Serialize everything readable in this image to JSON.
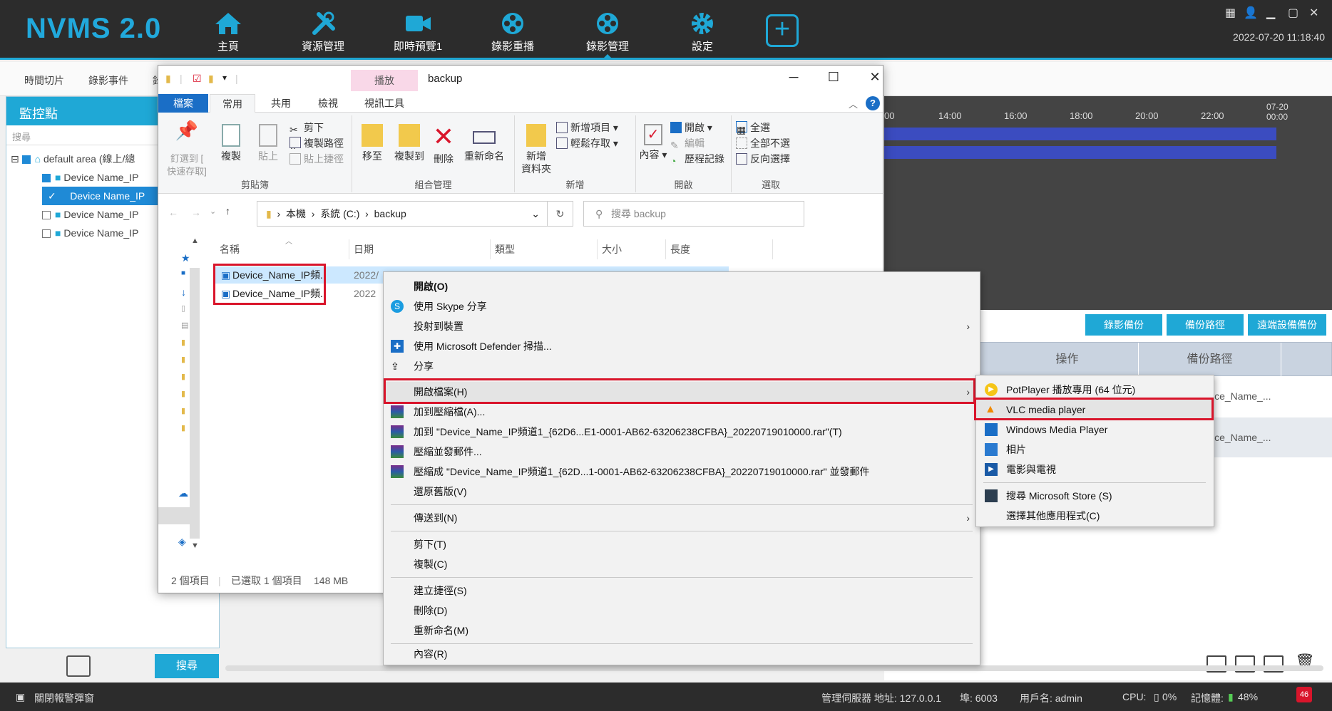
{
  "app": {
    "title": "NVMS 2.0",
    "datetime": "2022-07-20 11:18:40",
    "nav": [
      {
        "label": "主頁",
        "icon": "home-icon"
      },
      {
        "label": "資源管理",
        "icon": "tools-icon"
      },
      {
        "label": "即時預覽1",
        "icon": "camera-icon"
      },
      {
        "label": "錄影重播",
        "icon": "film-reel-icon"
      },
      {
        "label": "錄影管理",
        "icon": "film-reel-icon"
      },
      {
        "label": "設定",
        "icon": "gear-icon"
      }
    ],
    "subtabs": [
      "時間切片",
      "錄影事件",
      "錄"
    ],
    "left_panel": {
      "title": "監控點",
      "search_placeholder": "搜尋",
      "tree": [
        "default area (線上/總",
        "Device Name_IP",
        "Device Name_IP",
        "Device Name_IP",
        "Device Name_IP"
      ],
      "search_button": "搜尋"
    },
    "timeline_ticks": [
      "00",
      "14:00",
      "16:00",
      "18:00",
      "20:00",
      "22:00",
      "07-20",
      "00:00"
    ],
    "buttons": [
      "錄影備份",
      "備份路徑",
      "遠端設備備份"
    ],
    "grid_headers": [
      "操作",
      "備份路徑"
    ],
    "grid_values": [
      "ice_Name_...",
      "ice_Name_..."
    ],
    "status": {
      "alarm_popup": "關閉報警彈窗",
      "server": "管理伺服器 地址: 127.0.0.1",
      "port": "埠: 6003",
      "user": "用戶名: admin",
      "cpu": "CPU:",
      "cpu_val": "0%",
      "mem": "記憶體:",
      "mem_val": "48%",
      "badge": "46"
    }
  },
  "explorer": {
    "title": "backup",
    "tool_tab": "播放",
    "tool_tab_sub": "視訊工具",
    "ribbon_tabs": [
      "檔案",
      "常用",
      "共用",
      "檢視"
    ],
    "clipboard": {
      "pin": "釘選到 [\n快速存取]",
      "copy": "複製",
      "paste": "貼上",
      "cut": "剪下",
      "copy_path": "複製路徑",
      "paste_shortcut": "貼上捷徑",
      "label": "剪貼簿"
    },
    "organize": {
      "move": "移至",
      "copy_to": "複製到",
      "delete": "刪除",
      "rename": "重新命名",
      "label": "組合管理"
    },
    "new": {
      "new_folder": "新增\n資料夾",
      "new_item": "新增項目",
      "easy_access": "輕鬆存取",
      "label": "新增"
    },
    "open": {
      "properties": "內容",
      "open": "開啟",
      "edit": "編輯",
      "history": "歷程記錄",
      "label": "開啟"
    },
    "select": {
      "all": "全選",
      "none": "全部不選",
      "invert": "反向選擇",
      "label": "選取"
    },
    "address": {
      "parts": [
        "本機",
        "系統 (C:)",
        "backup"
      ],
      "search_placeholder": "搜尋 backup"
    },
    "columns": [
      "名稱",
      "日期",
      "類型",
      "大小",
      "長度"
    ],
    "files": [
      {
        "name": "Device_Name_IP頻...",
        "date": "2022/"
      },
      {
        "name": "Device_Name_IP頻...",
        "date": "2022"
      }
    ],
    "statusbar": {
      "count": "2 個項目",
      "selected": "已選取 1 個項目",
      "size": "148 MB"
    }
  },
  "context_menu": [
    {
      "label": "開啟(O)",
      "bold": true
    },
    {
      "label": "使用 Skype 分享",
      "icon": "skype-icon"
    },
    {
      "label": "投射到裝置",
      "submenu": true
    },
    {
      "label": "使用 Microsoft Defender 掃描...",
      "icon": "defender-shield-icon"
    },
    {
      "label": "分享",
      "icon": "share-icon"
    },
    {
      "label": "開啟檔案(H)",
      "submenu": true
    },
    {
      "label": "加到壓縮檔(A)...",
      "icon": "winrar-icon"
    },
    {
      "label": "加到 \"Device_Name_IP頻道1_{62D6...E1-0001-AB62-63206238CFBA}_20220719010000.rar\"(T)",
      "icon": "winrar-icon"
    },
    {
      "label": "壓縮並發郵件...",
      "icon": "winrar-icon"
    },
    {
      "label": "壓縮成 \"Device_Name_IP頻道1_{62D...1-0001-AB62-63206238CFBA}_20220719010000.rar\" 並發郵件",
      "icon": "winrar-icon"
    },
    {
      "label": "還原舊版(V)"
    },
    {
      "label": "傳送到(N)",
      "submenu": true
    },
    {
      "label": "剪下(T)"
    },
    {
      "label": "複製(C)"
    },
    {
      "label": "建立捷徑(S)"
    },
    {
      "label": "刪除(D)"
    },
    {
      "label": "重新命名(M)"
    },
    {
      "label": "內容(R)"
    }
  ],
  "submenu": [
    {
      "label": "PotPlayer 播放專用 (64 位元)",
      "icon": "potplayer-icon"
    },
    {
      "label": "VLC media player",
      "icon": "vlc-icon"
    },
    {
      "label": "Windows Media Player",
      "icon": "wmp-icon"
    },
    {
      "label": "相片",
      "icon": "photos-icon"
    },
    {
      "label": "電影與電視",
      "icon": "movies-tv-icon"
    },
    {
      "label": "搜尋 Microsoft Store (S)",
      "icon": "store-icon"
    },
    {
      "label": "選擇其他應用程式(C)"
    }
  ],
  "colors": {
    "accent": "#1fa8d6",
    "highlight": "#d9152b",
    "selection": "#cce8ff"
  }
}
